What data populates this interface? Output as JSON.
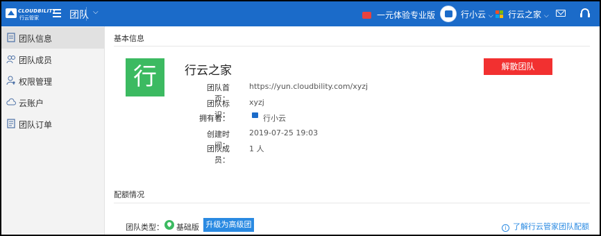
{
  "topbar": {
    "brand": "CLOUDBILITY",
    "brand_cn": "行云管家",
    "module_title": "团队",
    "plan_label": "一元体验专业版",
    "user_name": "行小云",
    "team_name": "行云之家",
    "icons": {
      "menu": "hamburger-icon",
      "module_dropdown": "chevron-down-icon",
      "plan": "gift-icon",
      "mail": "mail-icon",
      "support": "headset-icon"
    }
  },
  "sidebar": {
    "items": [
      {
        "label": "团队信息",
        "icon": "document-icon",
        "active": true
      },
      {
        "label": "团队成员",
        "icon": "people-icon",
        "active": false
      },
      {
        "label": "权限管理",
        "icon": "user-key-icon",
        "active": false
      },
      {
        "label": "云账户",
        "icon": "cloud-icon",
        "active": false
      },
      {
        "label": "团队订单",
        "icon": "order-icon",
        "active": false
      }
    ]
  },
  "basic_info": {
    "section_title": "基本信息",
    "icon_char": "行",
    "team_name": "行云之家",
    "disband_label": "解散团队",
    "fields": {
      "homepage_label": "团队首页：",
      "homepage_value": "https://yun.cloudbility.com/xyzj",
      "id_label": "团队标识：",
      "id_value": "xyzj",
      "owner_label": "拥有者：",
      "owner_value": "行小云",
      "created_label": "创建时间：",
      "created_value": "2019-07-25 19:03",
      "members_label": "团队成员：",
      "members_value": "1 人"
    }
  },
  "quota": {
    "section_title": "配额情况",
    "type_label": "团队类型：",
    "type_value": "基础版",
    "upgrade_label": "升级为高级团队",
    "learn_label": "了解行云管家团队配额"
  },
  "colors": {
    "topbar": "#1b6bc9",
    "accent": "#2a8ae2",
    "danger": "#f23030",
    "team_icon": "#3cba61"
  }
}
